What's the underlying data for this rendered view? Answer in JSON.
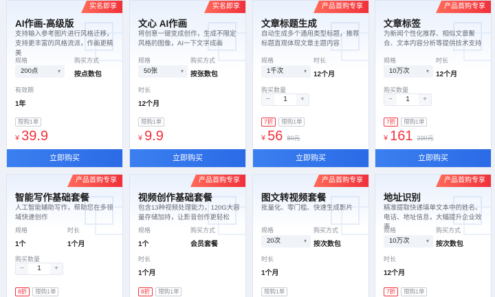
{
  "buy_label": "立即购买",
  "spec_label": "规格",
  "buy_method_label": "购买方式",
  "validity_label": "有效期",
  "duration_label": "时长",
  "quantity_label": "购买数量",
  "limit_tag": "限购1单",
  "currency": "¥",
  "accent_color": "#f0313a",
  "button_color": "#2b6be6",
  "cards": [
    {
      "badge": "实名即享",
      "title": "AI作画-高级版",
      "desc": "支持输入参考图片进行风格迁移，支持更丰富的风格流派，作画更精美",
      "spec": "200点",
      "buy_method": "按点数包",
      "validity": "1年",
      "price": "39.9"
    },
    {
      "badge": "实名即享",
      "title": "文心 AI作画",
      "desc": "将创意一键变成创作，生成不限定风格的图像，AI一下文字成画",
      "spec": "50张",
      "buy_method": "按张数包",
      "duration": "12个月",
      "price": "9.9"
    },
    {
      "badge": "产品首购专享",
      "title": "文章标题生成",
      "desc": "自动生成多个通用类型标题，推荐标题直观体现文章主题内容",
      "spec": "1千次",
      "duration": "12个月",
      "quantity": "1",
      "discount": "7折",
      "price": "56",
      "orig_price": "80元"
    },
    {
      "badge": "产品首购专享",
      "title": "文章标签",
      "desc": "为新闻个性化推荐、相似文章聚合、文本内容分析等提供技术支持",
      "spec": "10万次",
      "duration": "12个月",
      "quantity": "1",
      "discount": "7折",
      "price": "161",
      "orig_price": "230元"
    },
    {
      "badge": "产品首购专享",
      "title": "智能写作基础套餐",
      "desc": "人工智能辅助写作，帮助您在多领域快速创作",
      "spec": "1个",
      "duration": "1个月",
      "quantity": "1",
      "discount": "8折"
    },
    {
      "badge": "产品首购专享",
      "title": "视频创作基础套餐",
      "desc": "包含13种视频处理能力，120G大容量存储加持，让影音创作更轻松",
      "spec": "1个",
      "buy_method": "会员套餐",
      "duration": "1个月",
      "discount": "8折"
    },
    {
      "badge": "产品首购专享",
      "title": "图文转视频套餐",
      "desc": "批量化、零门槛、快速生成影片",
      "spec": "20次",
      "buy_method": "按次数包",
      "duration": "1个月"
    },
    {
      "badge": "产品首购专享",
      "title": "地址识别",
      "desc": "精准提取快递填单文本中的姓名、电话、地址信息，大幅提升企业效率",
      "spec": "10万次",
      "buy_method": "按次数包",
      "duration": "12个月",
      "discount": "7折"
    }
  ]
}
